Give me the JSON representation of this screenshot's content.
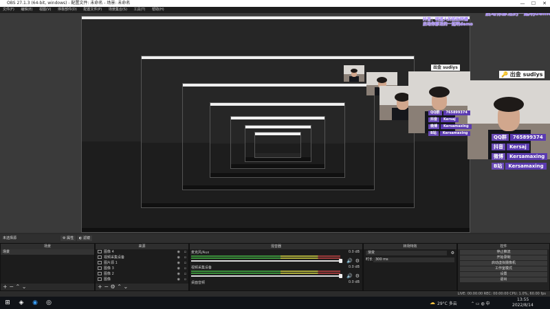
{
  "window": {
    "title": "OBS 27.1.3 (64-bit, windows) - 配置文件: 未命名 - 场景: 未命名",
    "controls": [
      "—",
      "☐",
      "✕"
    ]
  },
  "menu": [
    "文件(F)",
    "编辑(E)",
    "视图(V)",
    "停靠部件(D)",
    "配置文件(P)",
    "场景集合(S)",
    "工具(T)",
    "帮助(H)"
  ],
  "overlay": {
    "banner_line1": "抖音：明道人的前后转播",
    "banner_line2": "启动你那活的一起明demo",
    "donation_tag_icon": "🔑",
    "donation_tag": "出金",
    "donation_name": "sudiys",
    "socials": [
      {
        "key": "QQ群",
        "value": "765899374"
      },
      {
        "key": "抖音",
        "value": "Kersaj"
      },
      {
        "key": "微博",
        "value": "Kersamaxing"
      },
      {
        "key": "B站",
        "value": "Kersamaxing"
      }
    ]
  },
  "scene_bar": {
    "label": "未选择源",
    "props_label": "属性",
    "filters_label": "滤镜"
  },
  "docks": {
    "scenes": {
      "title": "场景",
      "items": [
        "场景"
      ]
    },
    "sources": {
      "title": "来源",
      "items": [
        "图像 4",
        "视频采集设备",
        "图片源 1",
        "图像 3",
        "图像 2",
        "图像"
      ]
    },
    "mixer": {
      "title": "混音器",
      "channels": [
        {
          "name": "麦克风/Aux",
          "db": "0.0 dB"
        },
        {
          "name": "视频采集设备",
          "db": "0.0 dB"
        },
        {
          "name": "桌面音频",
          "db": "0.0 dB"
        }
      ]
    },
    "transitions": {
      "title": "转场特效",
      "type": "渐变",
      "duration_label": "时长",
      "duration": "300 ms"
    },
    "controls": {
      "title": "控件",
      "buttons": [
        "停止推流",
        "开始录制",
        "启动虚拟摄像机",
        "工作室模式",
        "设置",
        "退出"
      ]
    }
  },
  "status": {
    "text": "LIVE: 00:00:00   REC: 00:00:00   CPU: 1.0%, 60.00 fps"
  },
  "taskbar": {
    "weather": "29°C 多云",
    "time": "13:55",
    "date": "2022/8/14"
  }
}
